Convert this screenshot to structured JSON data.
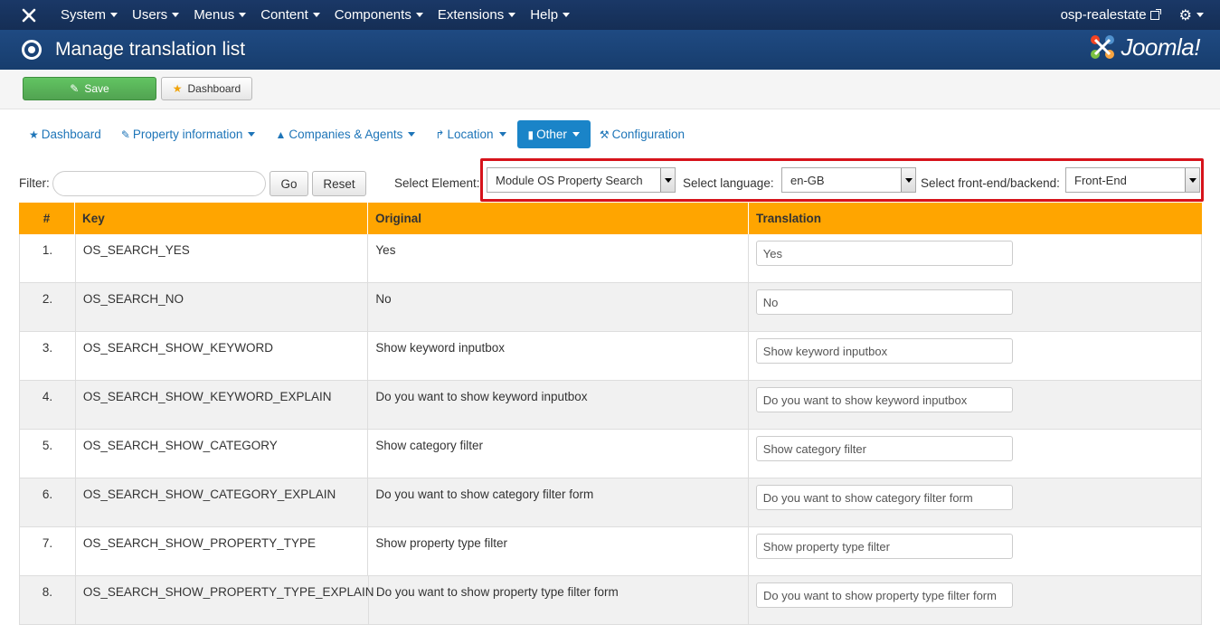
{
  "topnav": {
    "menu": [
      "System",
      "Users",
      "Menus",
      "Content",
      "Components",
      "Extensions",
      "Help"
    ],
    "site_name": "osp-realestate"
  },
  "header": {
    "title": "Manage translation list",
    "logo_text": "Joomla!"
  },
  "toolbar": {
    "save_label": "Save",
    "dashboard_label": "Dashboard"
  },
  "subnav": [
    {
      "label": "Dashboard",
      "icon": "star-icon",
      "dropdown": false,
      "active": false
    },
    {
      "label": "Property information",
      "icon": "edit-icon",
      "dropdown": true,
      "active": false
    },
    {
      "label": "Companies & Agents",
      "icon": "user-icon",
      "dropdown": true,
      "active": false
    },
    {
      "label": "Location",
      "icon": "share-icon",
      "dropdown": true,
      "active": false
    },
    {
      "label": "Other",
      "icon": "bookmark-icon",
      "dropdown": true,
      "active": true
    },
    {
      "label": "Configuration",
      "icon": "wrench-icon",
      "dropdown": false,
      "active": false
    }
  ],
  "filter": {
    "label": "Filter:",
    "value": "",
    "go_label": "Go",
    "reset_label": "Reset",
    "element_label": "Select Element:",
    "element_value": "Module OS Property Search",
    "language_label": "Select language:",
    "language_value": "en-GB",
    "side_label": "Select front-end/backend:",
    "side_value": "Front-End"
  },
  "table": {
    "columns": [
      "#",
      "Key",
      "Original",
      "Translation"
    ],
    "rows": [
      {
        "num": "1.",
        "key": "OS_SEARCH_YES",
        "original": "Yes",
        "translation": "Yes"
      },
      {
        "num": "2.",
        "key": "OS_SEARCH_NO",
        "original": "No",
        "translation": "No"
      },
      {
        "num": "3.",
        "key": "OS_SEARCH_SHOW_KEYWORD",
        "original": "Show keyword inputbox",
        "translation": "Show keyword inputbox"
      },
      {
        "num": "4.",
        "key": "OS_SEARCH_SHOW_KEYWORD_EXPLAIN",
        "original": "Do you want to show keyword inputbox",
        "translation": "Do you want to show keyword inputbox"
      },
      {
        "num": "5.",
        "key": "OS_SEARCH_SHOW_CATEGORY",
        "original": "Show category filter",
        "translation": "Show category filter"
      },
      {
        "num": "6.",
        "key": "OS_SEARCH_SHOW_CATEGORY_EXPLAIN",
        "original": "Do you want to show category filter form",
        "translation": "Do you want to show category filter form"
      },
      {
        "num": "7.",
        "key": "OS_SEARCH_SHOW_PROPERTY_TYPE",
        "original": "Show property type filter",
        "translation": "Show property type filter"
      },
      {
        "num": "8.",
        "key": "OS_SEARCH_SHOW_PROPERTY_TYPE_EXPLAIN",
        "original": "Do you want to show property type filter form",
        "translation": "Do you want to show property type filter form"
      }
    ]
  },
  "colors": {
    "topnav": "#17365d",
    "header": "#1f4a82",
    "table_header": "#ffa500",
    "highlight": "#d6131b",
    "save": "#51a351",
    "link": "#1e75b8"
  }
}
